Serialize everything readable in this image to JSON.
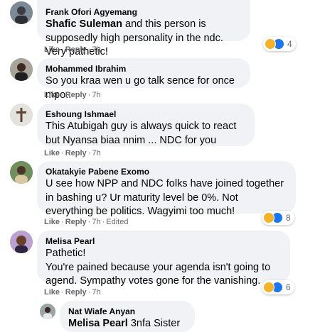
{
  "comments": [
    {
      "author": "Frank Ofori Agyemang",
      "mention": "Shafic Suleman",
      "text": "and this person is supposedly high personality in the ndc. Very pathetic!",
      "like": "Like",
      "reply": "Reply",
      "time": "7h",
      "reactions": "4"
    },
    {
      "author": "Mohammed Ibrahim",
      "text": "So you kraa wen u go talk sence for once mpo..",
      "like": "Like",
      "reply": "Reply",
      "time": "7h"
    },
    {
      "author": "Eshoung Ishmael",
      "text": "This Atubigah guy is always quick to react but Nyansa biaa nnim ... NDC for you",
      "like": "Like",
      "reply": "Reply",
      "time": "7h"
    },
    {
      "author": "Okatakyie Pabene Exomo",
      "text": "U see how NPP and NDC folks have joined together in bashing u? Ur maturity level be 0%. Not everything be politics. Wagyimi too much!",
      "like": "Like",
      "reply": "Reply",
      "time": "7h",
      "edited": "Edited",
      "reactions": "8"
    },
    {
      "author": "Melisa Pearl",
      "text": "Pathetic!\nYou're pained because your agenda isn't going to agend. Sympathy votes gone for the vanishing.",
      "like": "Like",
      "reply": "Reply",
      "time": "7h",
      "reactions": "6"
    },
    {
      "author": "Nat Wiafe Anyan",
      "mention": "Melisa Pearl",
      "text": "3nfa Sister"
    }
  ]
}
